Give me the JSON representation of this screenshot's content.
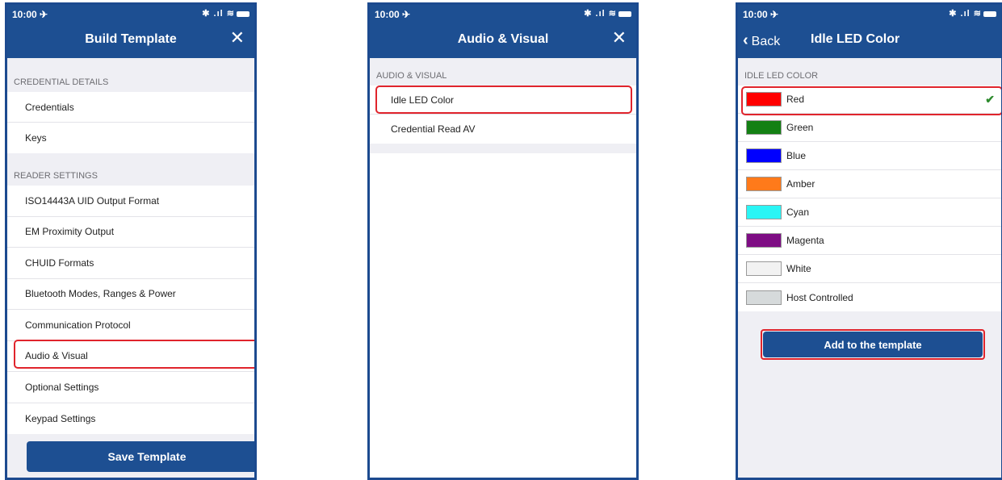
{
  "status": {
    "time": "10:00 ✈",
    "sys": "✱ .ıl ≋"
  },
  "screen1": {
    "title": "Build Template",
    "close": "✕",
    "sections": [
      {
        "header": "CREDENTIAL DETAILS",
        "items": [
          "Credentials",
          "Keys"
        ]
      },
      {
        "header": "READER SETTINGS",
        "items": [
          "ISO14443A UID Output Format",
          "EM Proximity Output",
          "CHUID Formats",
          "Bluetooth Modes, Ranges & Power",
          "Communication Protocol",
          "Audio & Visual",
          "Optional Settings",
          "Keypad Settings"
        ]
      }
    ],
    "save_button": "Save Template"
  },
  "screen2": {
    "title": "Audio & Visual",
    "close": "✕",
    "section_header": "AUDIO & VISUAL",
    "items": [
      "Idle LED Color",
      "Credential Read AV"
    ]
  },
  "screen3": {
    "back": "Back",
    "title": "Idle LED Color",
    "section_header": "IDLE LED COLOR",
    "colors": [
      {
        "label": "Red",
        "color": "#ff0000",
        "selected": true
      },
      {
        "label": "Green",
        "color": "#138013"
      },
      {
        "label": "Blue",
        "color": "#0000ff"
      },
      {
        "label": "Amber",
        "color": "#ff7a1a"
      },
      {
        "label": "Cyan",
        "color": "#2af5f5"
      },
      {
        "label": "Magenta",
        "color": "#7e0d84"
      },
      {
        "label": "White",
        "color": "#f2f2f2"
      },
      {
        "label": "Host Controlled",
        "color": "#d6dadb"
      }
    ],
    "check": "✔",
    "add_button": "Add to the template"
  }
}
